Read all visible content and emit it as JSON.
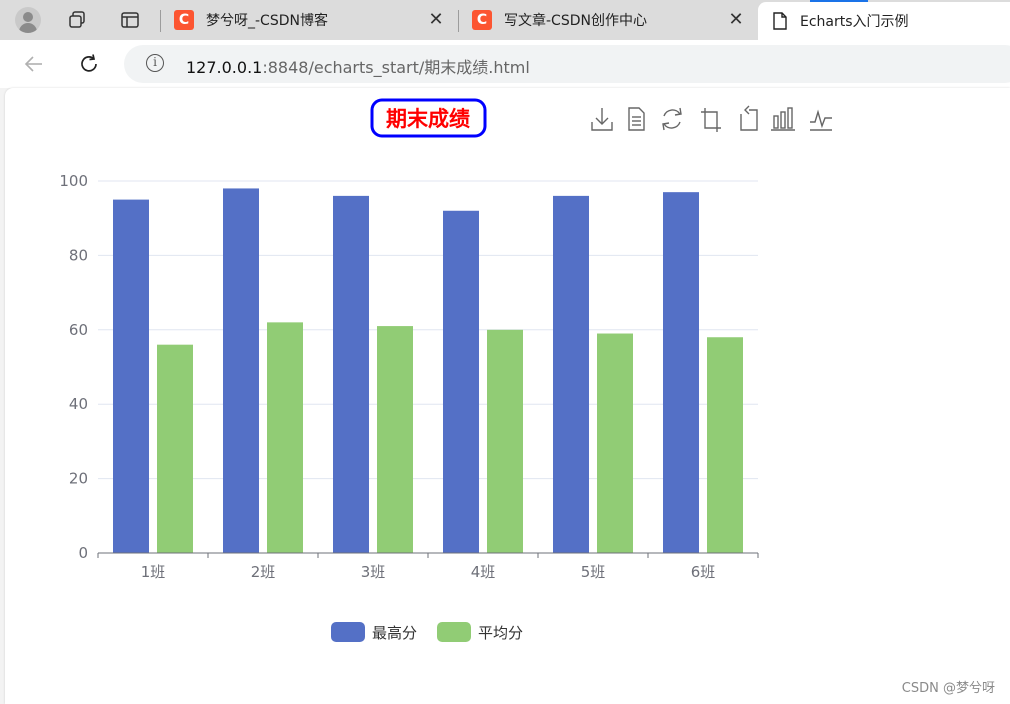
{
  "browser": {
    "tabs": [
      {
        "title": "梦兮呀_-CSDN博客",
        "favicon": "C",
        "active": false
      },
      {
        "title": "写文章-CSDN创作中心",
        "favicon": "C",
        "active": false
      },
      {
        "title": "Echarts入门示例",
        "active": true
      }
    ],
    "url_host": "127.0.0.1",
    "url_rest": ":8848/echarts_start/期末成绩.html"
  },
  "page": {
    "watermark": "CSDN @梦兮呀"
  },
  "colors": {
    "series1": "#5470c6",
    "series2": "#91cc75",
    "title": "#ff0000",
    "title_border": "#0000ff"
  },
  "chart_data": {
    "type": "bar",
    "title": "期末成绩",
    "categories": [
      "1班",
      "2班",
      "3班",
      "4班",
      "5班",
      "6班"
    ],
    "series": [
      {
        "name": "最高分",
        "values": [
          95,
          98,
          96,
          92,
          96,
          97
        ]
      },
      {
        "name": "平均分",
        "values": [
          56,
          62,
          61,
          60,
          59,
          58
        ]
      }
    ],
    "y_ticks": [
      0,
      20,
      40,
      60,
      80,
      100
    ],
    "ylim": [
      0,
      100
    ],
    "grid": true,
    "legend_position": "bottom-center",
    "toolbox": [
      "save-as-image",
      "data-view",
      "restore",
      "zoom",
      "zoom-reset",
      "bar-type",
      "line-type"
    ]
  }
}
